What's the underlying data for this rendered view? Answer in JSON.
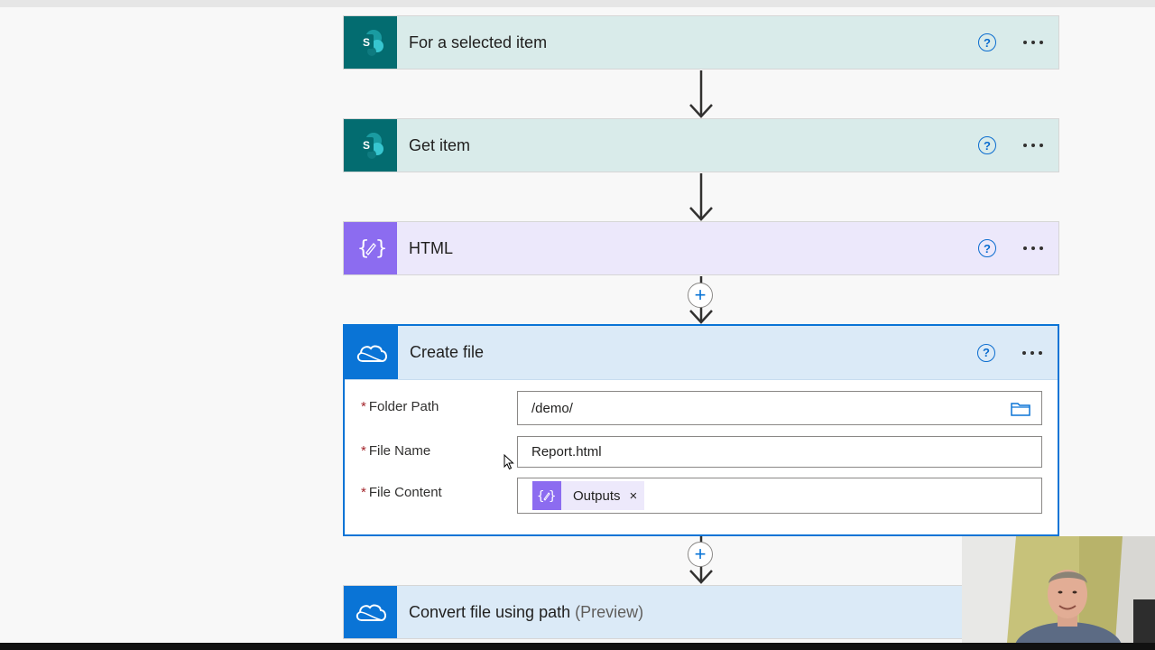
{
  "flow": {
    "steps": [
      {
        "title": "For a selected item",
        "icon": "sharepoint-icon"
      },
      {
        "title": "Get item",
        "icon": "sharepoint-icon"
      },
      {
        "title": "HTML",
        "icon": "data-operation-icon"
      },
      {
        "title": "Create file",
        "icon": "onedrive-icon"
      },
      {
        "title": "Convert file using path",
        "suffix": "(Preview)",
        "icon": "onedrive-icon"
      }
    ],
    "help_glyph": "?"
  },
  "create_file": {
    "fields": [
      {
        "label": "Folder Path",
        "value": "/demo/"
      },
      {
        "label": "File Name",
        "value": "Report.html"
      },
      {
        "label": "File Content",
        "token": "Outputs"
      }
    ],
    "required_marker": "*",
    "token_remove": "×"
  },
  "add_glyph": "+",
  "colors": {
    "sharepoint": "#036c70",
    "data_operation": "#8c6cf0",
    "onedrive": "#0a74d6",
    "selected_border": "#0a74d6"
  }
}
